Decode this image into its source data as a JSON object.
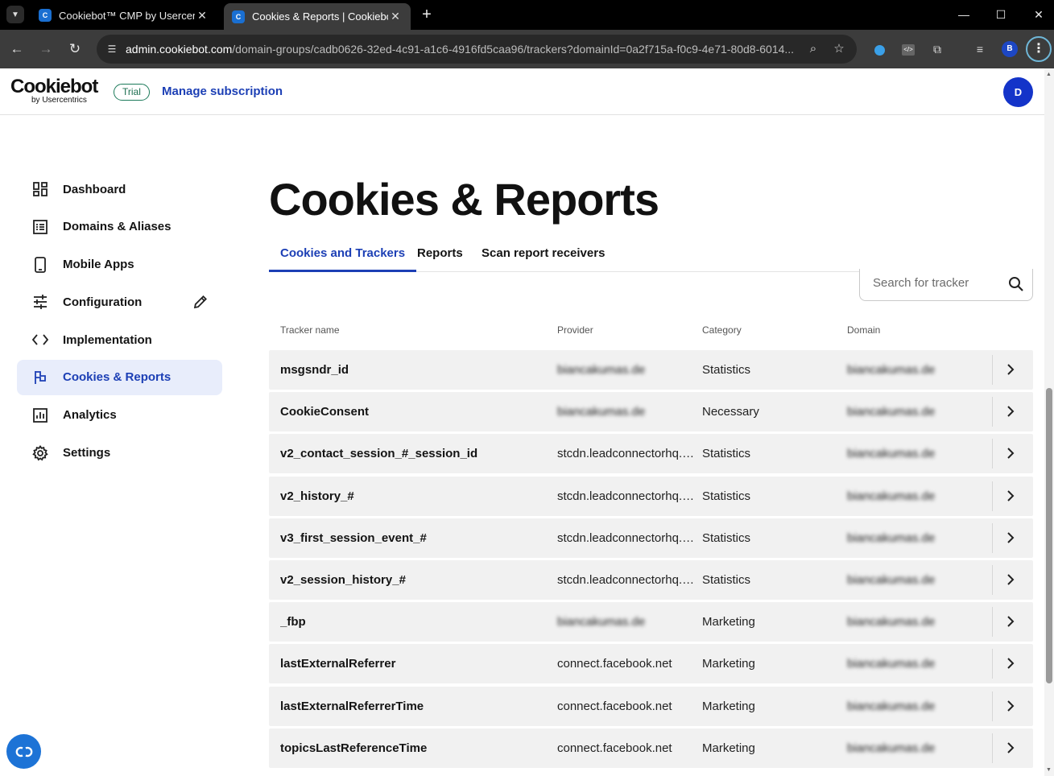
{
  "browser": {
    "tabs": [
      {
        "title": "Cookiebot™ CMP by Usercentri",
        "active": false
      },
      {
        "title": "Cookies & Reports | Cookiebot",
        "active": true
      }
    ],
    "url_host": "admin.cookiebot.com",
    "url_path": "/domain-groups/cadb0626-32ed-4c91-a1c6-4916fd5caa96/trackers?domainId=0a2f715a-f0c9-4e71-80d8-6014...",
    "profile_initial": "B"
  },
  "header": {
    "logo_main": "Cookiebot",
    "logo_sub": "by Usercentrics",
    "trial_badge": "Trial",
    "manage_link": "Manage subscription",
    "avatar_initial": "D"
  },
  "sidebar": {
    "items": [
      {
        "label": "Dashboard",
        "icon": "dashboard-icon",
        "active": false
      },
      {
        "label": "Domains & Aliases",
        "icon": "list-icon",
        "active": false
      },
      {
        "label": "Mobile Apps",
        "icon": "phone-icon",
        "active": false
      },
      {
        "label": "Configuration",
        "icon": "sliders-icon",
        "active": false
      },
      {
        "label": "Implementation",
        "icon": "code-icon",
        "active": false
      },
      {
        "label": "Cookies & Reports",
        "icon": "flag-icon",
        "active": true
      },
      {
        "label": "Analytics",
        "icon": "chart-icon",
        "active": false
      },
      {
        "label": "Settings",
        "icon": "gear-icon",
        "active": false
      }
    ]
  },
  "main": {
    "title": "Cookies & Reports",
    "tabs": [
      {
        "label": "Cookies and Trackers",
        "active": true
      },
      {
        "label": "Reports",
        "active": false
      },
      {
        "label": "Scan report receivers",
        "active": false
      }
    ],
    "search_placeholder": "Search for tracker",
    "columns": {
      "name": "Tracker name",
      "provider": "Provider",
      "category": "Category",
      "domain": "Domain"
    },
    "rows": [
      {
        "name": "msgsndr_id",
        "provider": "biancakumas.de",
        "provider_blurred": true,
        "category": "Statistics",
        "domain": "biancakumas.de"
      },
      {
        "name": "CookieConsent",
        "provider": "biancakumas.de",
        "provider_blurred": true,
        "category": "Necessary",
        "domain": "biancakumas.de"
      },
      {
        "name": "v2_contact_session_#_session_id",
        "provider": "stcdn.leadconnectorhq.c...",
        "provider_blurred": false,
        "category": "Statistics",
        "domain": "biancakumas.de"
      },
      {
        "name": "v2_history_#",
        "provider": "stcdn.leadconnectorhq.c...",
        "provider_blurred": false,
        "category": "Statistics",
        "domain": "biancakumas.de"
      },
      {
        "name": "v3_first_session_event_#",
        "provider": "stcdn.leadconnectorhq.c...",
        "provider_blurred": false,
        "category": "Statistics",
        "domain": "biancakumas.de"
      },
      {
        "name": "v2_session_history_#",
        "provider": "stcdn.leadconnectorhq.c...",
        "provider_blurred": false,
        "category": "Statistics",
        "domain": "biancakumas.de"
      },
      {
        "name": "_fbp",
        "provider": "biancakumas.de",
        "provider_blurred": true,
        "category": "Marketing",
        "domain": "biancakumas.de"
      },
      {
        "name": "lastExternalReferrer",
        "provider": "connect.facebook.net",
        "provider_blurred": false,
        "category": "Marketing",
        "domain": "biancakumas.de"
      },
      {
        "name": "lastExternalReferrerTime",
        "provider": "connect.facebook.net",
        "provider_blurred": false,
        "category": "Marketing",
        "domain": "biancakumas.de"
      },
      {
        "name": "topicsLastReferenceTime",
        "provider": "connect.facebook.net",
        "provider_blurred": false,
        "category": "Marketing",
        "domain": "biancakumas.de"
      }
    ]
  },
  "colors": {
    "accent": "#1c3fb5",
    "active_nav_bg": "#e8edfb",
    "row_bg": "#f1f1f1",
    "avatar": "#1434c9"
  }
}
